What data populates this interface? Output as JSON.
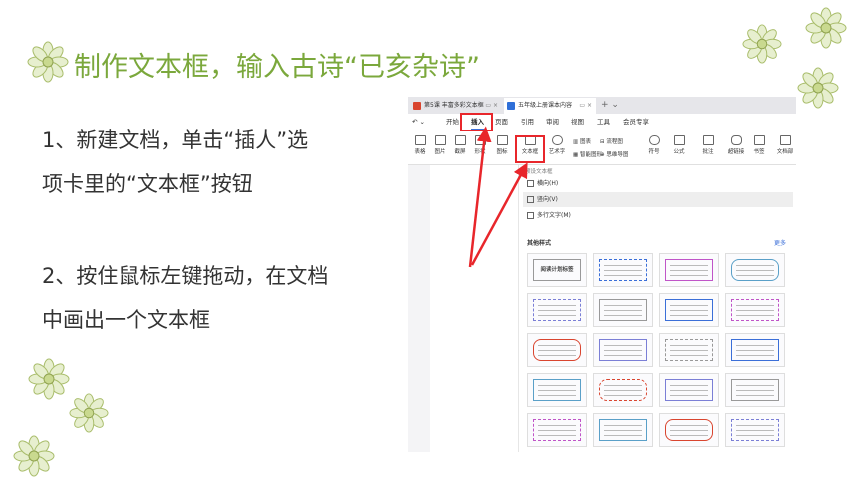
{
  "slide": {
    "title": "制作文本框，输入古诗“已亥杂诗”",
    "steps": [
      {
        "line1": "1、新建文档，单击“插人”选",
        "line2": "项卡里的“文本框”按钮"
      },
      {
        "line1": "2、按住鼠标左键拖动，在文档",
        "line2": "中画出一个文本框"
      }
    ]
  },
  "colors": {
    "title": "#7ba83c",
    "highlight": "#e8262b",
    "flower_fill": "#e7efcf",
    "flower_stroke": "#a9bd6b"
  },
  "app": {
    "tabs": [
      {
        "label": "第5课 丰富多彩文本框",
        "icon": "presentation-icon",
        "color": "#d9452f"
      },
      {
        "label": "五年级上册课本内容",
        "icon": "word-icon",
        "color": "#2f6fd8"
      }
    ],
    "new_tab": "+ ⌄",
    "menus": [
      "开始",
      "插入",
      "页面",
      "引用",
      "审阅",
      "视图",
      "工具",
      "会员专享"
    ],
    "active_menu": "插入",
    "ribbon": {
      "table": "表格",
      "picture": "图片",
      "screenshot": "截屏",
      "shape": "形状",
      "icon": "图标",
      "textbox": "文本框",
      "wordart": "艺术字",
      "chart": "图表",
      "flowchart": "流程图",
      "smartart": "智能图形",
      "mindmap": "思维导图",
      "symbol": "符号",
      "formula": "公式",
      "annotation": "批注",
      "hyperlink": "超链接",
      "bookmark": "书签",
      "docparts": "文档部"
    },
    "panel": {
      "title": "预设文本框",
      "items": [
        "横向(H)",
        "竖向(V)",
        "多行文字(M)"
      ],
      "selected_item": "竖向(V)",
      "section_title": "其他样式",
      "more": "更多",
      "thumb_label": "阅读计划标签"
    }
  }
}
